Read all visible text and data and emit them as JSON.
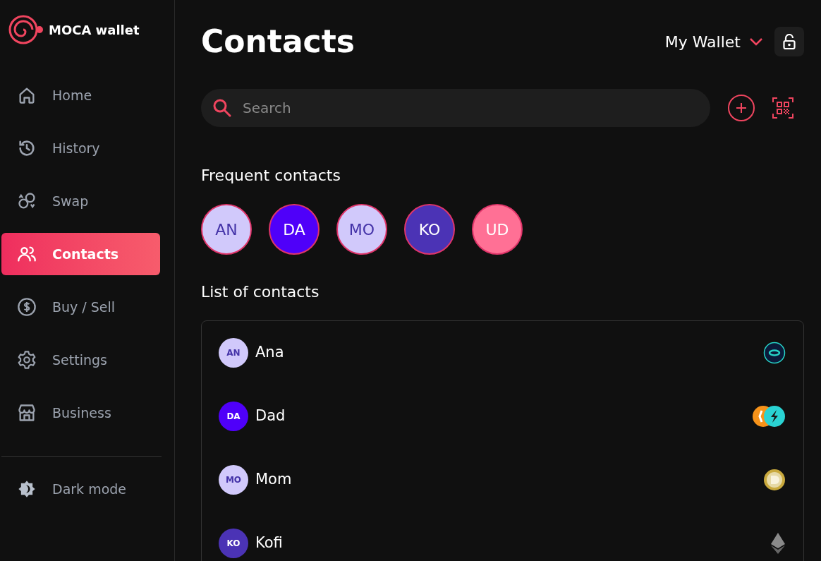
{
  "brand": {
    "name": "MOCA wallet"
  },
  "sidebar": {
    "items": [
      {
        "label": "Home",
        "selected": false
      },
      {
        "label": "History",
        "selected": false
      },
      {
        "label": "Swap",
        "selected": false
      },
      {
        "label": "Contacts",
        "selected": true
      },
      {
        "label": "Buy / Sell",
        "selected": false
      },
      {
        "label": "Settings",
        "selected": false
      },
      {
        "label": "Business",
        "selected": false
      }
    ],
    "footer_item": {
      "label": "Dark mode"
    }
  },
  "header": {
    "title": "Contacts",
    "wallet": "My Wallet"
  },
  "search": {
    "placeholder": "Search"
  },
  "frequent": {
    "title": "Frequent contacts",
    "contacts": [
      {
        "initials": "AN",
        "color": "#d1c9fb"
      },
      {
        "initials": "DA",
        "color": "#4f00f9"
      },
      {
        "initials": "MO",
        "color": "#d1c9fb"
      },
      {
        "initials": "KO",
        "color": "#4b33b5"
      },
      {
        "initials": "UD",
        "color": "#ff7095"
      }
    ]
  },
  "list": {
    "title": "List of contacts",
    "contacts": [
      {
        "initials": "AN",
        "name": "Ana",
        "color": "#d1c9fb",
        "coins": [
          {
            "kind": "ring"
          }
        ]
      },
      {
        "initials": "DA",
        "name": "Dad",
        "color": "#4f00f9",
        "coins": [
          {
            "kind": "orange"
          },
          {
            "kind": "bolt"
          }
        ]
      },
      {
        "initials": "MO",
        "name": "Mom",
        "color": "#d1c9fb",
        "coins": [
          {
            "kind": "gold"
          }
        ]
      },
      {
        "initials": "KO",
        "name": "Kofi",
        "color": "#4b33b5",
        "coins": [
          {
            "kind": "diamond"
          }
        ]
      }
    ]
  }
}
